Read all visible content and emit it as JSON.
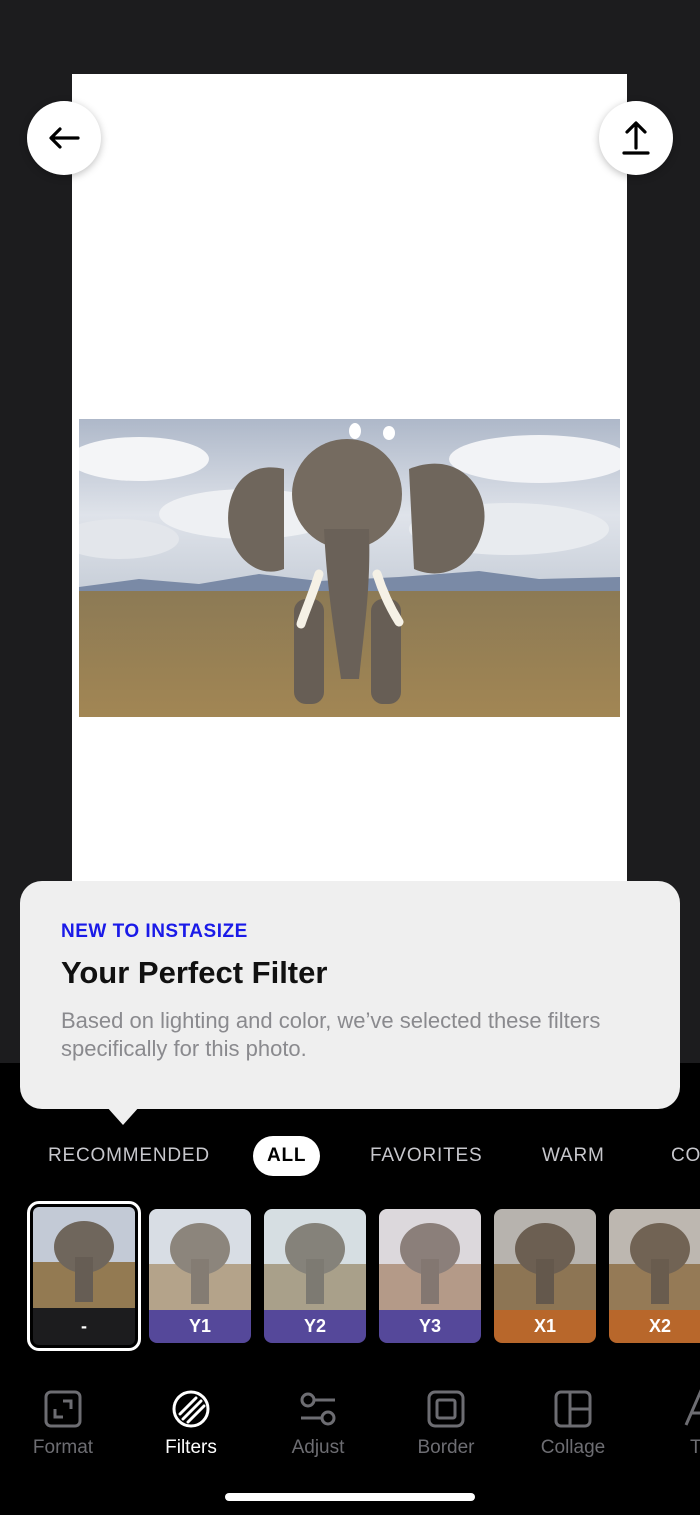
{
  "toolbar": {
    "back_icon": "arrow-left-icon",
    "share_icon": "share-upload-icon"
  },
  "tooltip": {
    "kicker": "NEW TO INSTASIZE",
    "title": "Your Perfect Filter",
    "body": "Based on lighting and color, we’ve selected these filters specifically for this photo."
  },
  "categories": [
    {
      "label": "RECOMMENDED",
      "active": false
    },
    {
      "label": "ALL",
      "active": true
    },
    {
      "label": "FAVORITES",
      "active": false
    },
    {
      "label": "WARM",
      "active": false
    },
    {
      "label": "CO",
      "active": false
    }
  ],
  "filters": [
    {
      "label": "-",
      "color": "#1c1c1e",
      "selected": true
    },
    {
      "label": "Y1",
      "color": "#55489a",
      "selected": false
    },
    {
      "label": "Y2",
      "color": "#55489a",
      "selected": false
    },
    {
      "label": "Y3",
      "color": "#55489a",
      "selected": false
    },
    {
      "label": "X1",
      "color": "#b8672b",
      "selected": false
    },
    {
      "label": "X2",
      "color": "#b8672b",
      "selected": false
    }
  ],
  "tabs": [
    {
      "label": "Format",
      "icon": "format-icon",
      "active": false
    },
    {
      "label": "Filters",
      "icon": "filters-icon",
      "active": true
    },
    {
      "label": "Adjust",
      "icon": "adjust-icon",
      "active": false
    },
    {
      "label": "Border",
      "icon": "border-icon",
      "active": false
    },
    {
      "label": "Collage",
      "icon": "collage-icon",
      "active": false
    },
    {
      "label": "Te",
      "icon": "text-icon",
      "active": false
    }
  ]
}
